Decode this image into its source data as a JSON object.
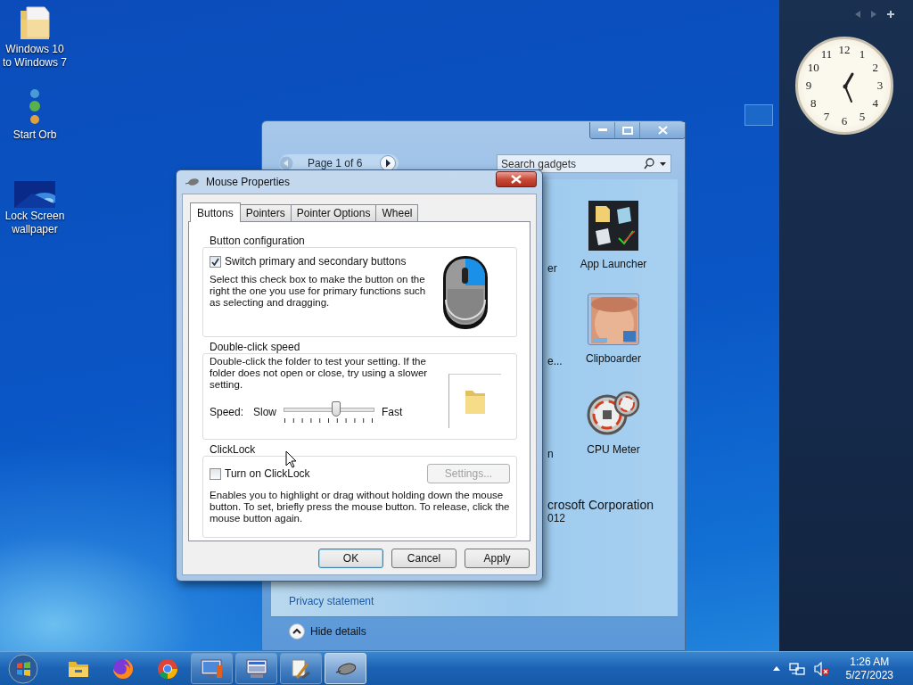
{
  "desktop_icons": [
    {
      "kind": "folder",
      "lines": [
        "Windows 10",
        "to Windows 7"
      ]
    },
    {
      "kind": "orbs",
      "lines": [
        "Start Orb"
      ]
    },
    {
      "kind": "wallpaper",
      "lines": [
        "Lock Screen",
        "wallpaper"
      ]
    }
  ],
  "gadget_sidebar": {
    "clock": {
      "numbers": [
        "12",
        "1",
        "2",
        "3",
        "4",
        "5",
        "6",
        "7",
        "8",
        "9",
        "10",
        "11"
      ]
    }
  },
  "gadget_gallery": {
    "page": "Page 1 of 6",
    "search": {
      "placeholder": "Search gadgets"
    },
    "gadgets": [
      {
        "kind": "hidden",
        "label": "er"
      },
      {
        "kind": "hidden",
        "label": "e..."
      },
      {
        "kind": "hidden",
        "label": "n"
      },
      {
        "kind": "launcher",
        "label": "App Launcher"
      },
      {
        "kind": "picture",
        "label": "Clipboarder"
      },
      {
        "kind": "meter",
        "label": "CPU Meter"
      }
    ],
    "publisher": "crosoft Corporation",
    "year": "012",
    "privacy_link": "Privacy statement",
    "details_toggle": "Hide details"
  },
  "mouse_properties": {
    "title": "Mouse Properties",
    "tabs": [
      {
        "label": "Buttons",
        "selected": true
      },
      {
        "label": "Pointers",
        "selected": false
      },
      {
        "label": "Pointer Options",
        "selected": false
      },
      {
        "label": "Wheel",
        "selected": false
      }
    ],
    "button_configuration": {
      "heading": "Button configuration",
      "checkbox": {
        "label": "Switch primary and secondary buttons",
        "checked": true
      },
      "description": "Select this check box to make the button on the right the one you use for primary functions such as selecting and dragging."
    },
    "double_click": {
      "heading": "Double-click speed",
      "description": "Double-click the folder to test your setting. If the folder does not open or close, try using a slower setting.",
      "speed_label": "Speed:",
      "slow": "Slow",
      "fast": "Fast",
      "level": 0.59
    },
    "clicklock": {
      "heading": "ClickLock",
      "checkbox": {
        "label": "Turn on ClickLock",
        "checked": false
      },
      "settings_button": {
        "label": "Settings...",
        "disabled": true
      },
      "description": "Enables you to highlight or drag without holding down the mouse button. To set, briefly press the mouse button. To release, click the mouse button again."
    },
    "buttons": [
      {
        "label": "OK",
        "default": true
      },
      {
        "label": "Cancel",
        "default": false
      },
      {
        "label": "Apply",
        "default": false
      }
    ]
  },
  "taskbar": {
    "pinned": [
      {
        "kind": "folder"
      },
      {
        "kind": "firefox"
      },
      {
        "kind": "chrome"
      }
    ],
    "windows": [
      {
        "kind": "display",
        "selected": false
      },
      {
        "kind": "monitor",
        "selected": false
      },
      {
        "kind": "tools",
        "selected": false
      },
      {
        "kind": "mouse",
        "selected": true
      }
    ],
    "time": "1:26 AM",
    "date": "5/27/2023"
  }
}
